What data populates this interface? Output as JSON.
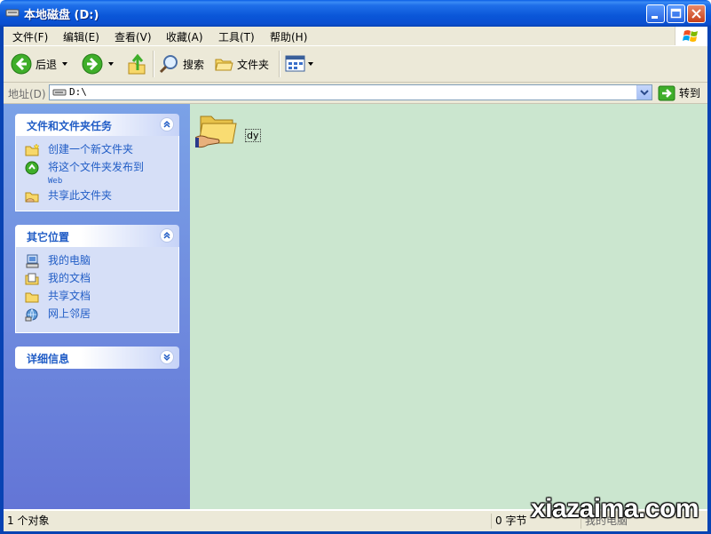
{
  "window": {
    "title": "本地磁盘 (D:)",
    "icon": "drive-icon",
    "controls": [
      "minimize",
      "maximize",
      "close"
    ]
  },
  "menu": {
    "items": [
      "文件(F)",
      "编辑(E)",
      "查看(V)",
      "收藏(A)",
      "工具(T)",
      "帮助(H)"
    ]
  },
  "toolbar": {
    "back_label": "后退",
    "search_label": "搜索",
    "folders_label": "文件夹"
  },
  "address": {
    "label": "地址(D)",
    "path": "D:\\",
    "go_label": "转到"
  },
  "taskpane": {
    "file_tasks": {
      "title": "文件和文件夹任务",
      "items": [
        {
          "label": "创建一个新文件夹",
          "icon": "new-folder-icon"
        },
        {
          "label": "将这个文件夹发布到",
          "sub": "Web",
          "icon": "publish-web-icon"
        },
        {
          "label": "共享此文件夹",
          "icon": "share-folder-icon"
        }
      ]
    },
    "other_places": {
      "title": "其它位置",
      "items": [
        {
          "label": "我的电脑",
          "icon": "my-computer-icon"
        },
        {
          "label": "我的文档",
          "icon": "my-documents-icon"
        },
        {
          "label": "共享文档",
          "icon": "shared-documents-icon"
        },
        {
          "label": "网上邻居",
          "icon": "network-places-icon"
        }
      ]
    },
    "details": {
      "title": "详细信息"
    }
  },
  "content": {
    "items": [
      {
        "name": "dy",
        "type": "shared-folder"
      }
    ]
  },
  "status": {
    "objects": "1 个对象",
    "size": "0 字节",
    "location": "我的电脑"
  },
  "watermark": "xiazaima.com",
  "colors": {
    "titlebar": "#0a56d8",
    "task_link": "#215dc6",
    "content_bg": "#cbe6cf",
    "pane_bg": "#7ba2e7"
  }
}
